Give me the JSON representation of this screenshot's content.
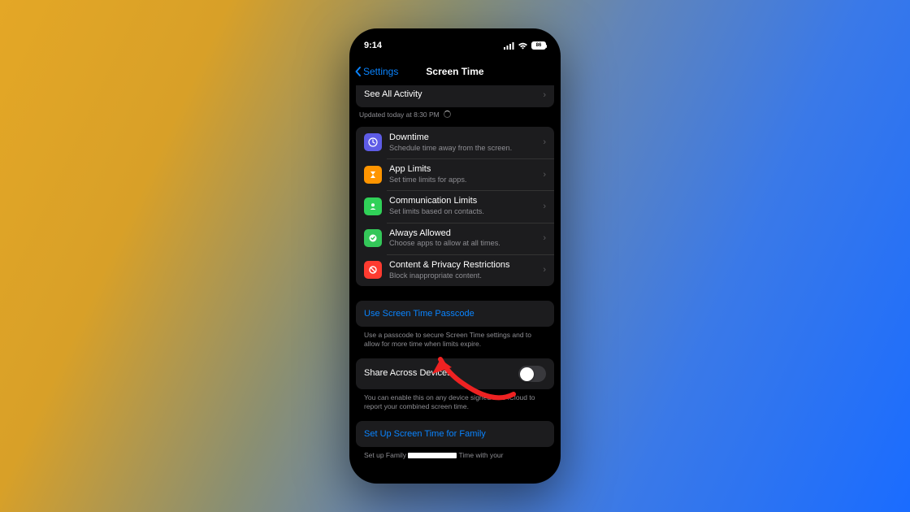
{
  "status": {
    "time": "9:14",
    "battery": "86"
  },
  "nav": {
    "back_label": "Settings",
    "title": "Screen Time"
  },
  "see_all": {
    "label": "See All Activity",
    "updated_prefix": "Updated today at 8:30 PM"
  },
  "limits": [
    {
      "title": "Downtime",
      "sub": "Schedule time away from the screen.",
      "icon": "downtime"
    },
    {
      "title": "App Limits",
      "sub": "Set time limits for apps.",
      "icon": "applimits"
    },
    {
      "title": "Communication Limits",
      "sub": "Set limits based on contacts.",
      "icon": "comm"
    },
    {
      "title": "Always Allowed",
      "sub": "Choose apps to allow at all times.",
      "icon": "always"
    },
    {
      "title": "Content & Privacy Restrictions",
      "sub": "Block inappropriate content.",
      "icon": "content"
    }
  ],
  "passcode": {
    "label": "Use Screen Time Passcode",
    "footer": "Use a passcode to secure Screen Time settings and to allow for more time when limits expire."
  },
  "share": {
    "label": "Share Across Devices",
    "footer": "You can enable this on any device signed in to iCloud to report your combined screen time."
  },
  "family": {
    "label": "Set Up Screen Time for Family",
    "footer_prefix": "Set up Family ",
    "footer_suffix": " Time with your"
  }
}
